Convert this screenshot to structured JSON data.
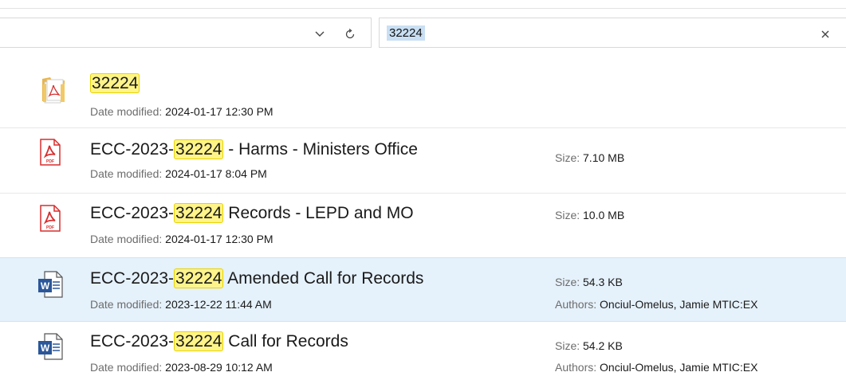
{
  "search": {
    "query": "32224"
  },
  "results": [
    {
      "type": "folder",
      "title_pre": "",
      "title_hl": "32224",
      "title_post": "",
      "date_label": "Date modified: ",
      "date": "2024-01-17 12:30 PM"
    },
    {
      "type": "pdf",
      "title_pre": "ECC-2023-",
      "title_hl": "32224",
      "title_post": " - Harms - Ministers Office",
      "date_label": "Date modified: ",
      "date": "2024-01-17 8:04 PM",
      "size_label": "Size: ",
      "size": "7.10 MB"
    },
    {
      "type": "pdf",
      "title_pre": "ECC-2023-",
      "title_hl": "32224",
      "title_post": " Records - LEPD and MO",
      "date_label": "Date modified: ",
      "date": "2024-01-17 12:30 PM",
      "size_label": "Size: ",
      "size": "10.0 MB"
    },
    {
      "type": "word",
      "title_pre": "ECC-2023-",
      "title_hl": "32224",
      "title_post": " Amended Call for Records",
      "date_label": "Date modified: ",
      "date": "2023-12-22 11:44 AM",
      "size_label": "Size: ",
      "size": "54.3 KB",
      "authors_label": "Authors: ",
      "authors": "Onciul-Omelus, Jamie MTIC:EX"
    },
    {
      "type": "word",
      "title_pre": "ECC-2023-",
      "title_hl": "32224",
      "title_post": " Call for Records",
      "date_label": "Date modified: ",
      "date": "2023-08-29 10:12 AM",
      "size_label": "Size: ",
      "size": "54.2 KB",
      "authors_label": "Authors: ",
      "authors": "Onciul-Omelus, Jamie MTIC:EX"
    }
  ],
  "colors": {
    "selection": "#e5f1fb",
    "highlight": "#fff48a",
    "pdf_red": "#d72f2f",
    "word_blue": "#2b579a"
  }
}
